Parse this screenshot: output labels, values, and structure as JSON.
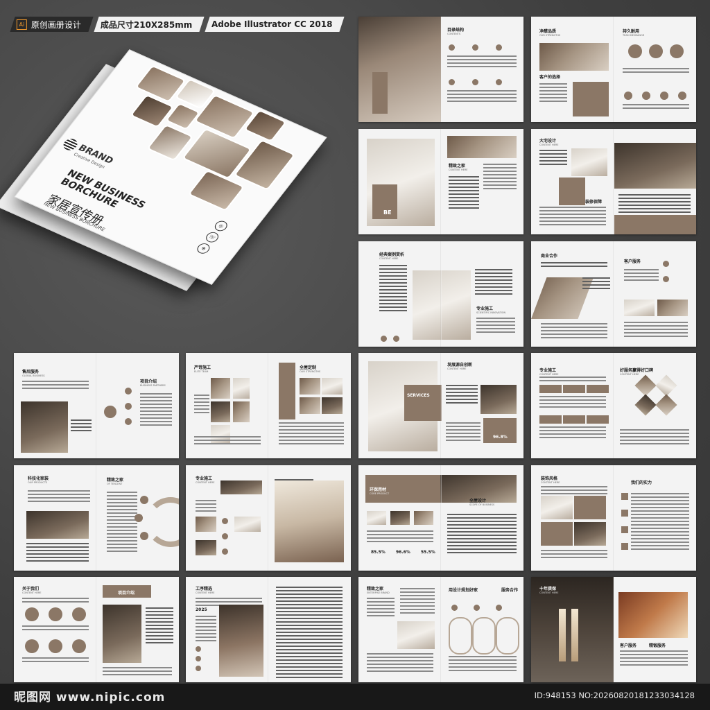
{
  "header": {
    "ai_badge": "Ai",
    "label_original": "原创画册设计",
    "label_size": "成品尺寸210X285mm",
    "label_software": "Adobe Illustrator CC 2018"
  },
  "cover": {
    "brand": "BRAND",
    "brand_sub": "Creative Design",
    "title_en": "NEW BUSINESS BORCHURE",
    "title_cn": "家居宣传册",
    "subtitle_en": "NEW BUSINESS BORCHURE"
  },
  "spreads": {
    "s1": {
      "title": "目录结构",
      "sub": "CONTENTS"
    },
    "s2": {
      "title_l": "净醛品质",
      "sub_l": "OUR STRENGTHS",
      "sub_l2": "客户的选择",
      "title_r": "持久耐用",
      "sub_r": "TEAM DEMEANOR"
    },
    "s3": {
      "title": "精致之家",
      "sub": "CONTENT HERE",
      "badge": "BE"
    },
    "s4": {
      "title": "大宅设计",
      "sub": "CONTENT HERE",
      "sub2": "装修保障"
    },
    "s5": {
      "title": "经典案例赏析",
      "sub": "CONTENT HERE",
      "sub2": "专业施工",
      "sub3": "SCIENTIFIC INNOVATION"
    },
    "s6": {
      "title": "商业合作",
      "sub": "客户服务"
    },
    "s7": {
      "title": "售后服务",
      "sub": "GLOBAL BUSINESS",
      "sub2": "项目介绍",
      "sub3": "BUSINESS PARTNERS"
    },
    "s8": {
      "title": "严苛施工",
      "sub": "ELITE TEAM",
      "title_r": "全屋定制",
      "sub_r": "OUR STRENGTHS"
    },
    "s9": {
      "title": "发展源自创新",
      "sub": "CONTENT HERE",
      "services": "SERVICES",
      "percent": "96.8%"
    },
    "s10": {
      "title": "专业施工",
      "sub": "CONTENT HERE",
      "title_r": "好服务赢得好口碑",
      "sub_r": "CONTENT HERE"
    },
    "s11": {
      "title": "科技化家装",
      "sub": "OUR PRODUCTS",
      "title_r": "精致之家",
      "sub_r": "OF TENCENT"
    },
    "s12": {
      "title": "专业施工",
      "sub": "CONTENT HERE"
    },
    "s13": {
      "title": "环保用材",
      "sub": "CORE PRODUCT",
      "title_r": "全屋设计",
      "sub_r": "SCOPE OF BUSINESS",
      "p1": "85.5%",
      "p2": "96.6%",
      "p3": "55.5%"
    },
    "s14": {
      "title": "装饰风格",
      "sub": "CONTENT HERE",
      "r1": "我们的实力"
    },
    "s15": {
      "title": "关于我们",
      "sub": "CONTENT HERE",
      "r1": "项目介绍"
    },
    "s16": {
      "title": "工序精选",
      "sub": "CONTENT HERE",
      "year": "2025"
    },
    "s17": {
      "title": "精致之家",
      "sub": "ENTERPISE BRAND",
      "title_r": "用设计规划好家",
      "r1": "服务合作"
    },
    "s18": {
      "title": "十年质保",
      "sub": "CONTENT HERE",
      "r1": "客户服务",
      "r2": "精锻服务"
    }
  },
  "footer": {
    "site": "昵图网 www.nipic.com",
    "id": "ID:948153 NO:20260820181233034128"
  }
}
